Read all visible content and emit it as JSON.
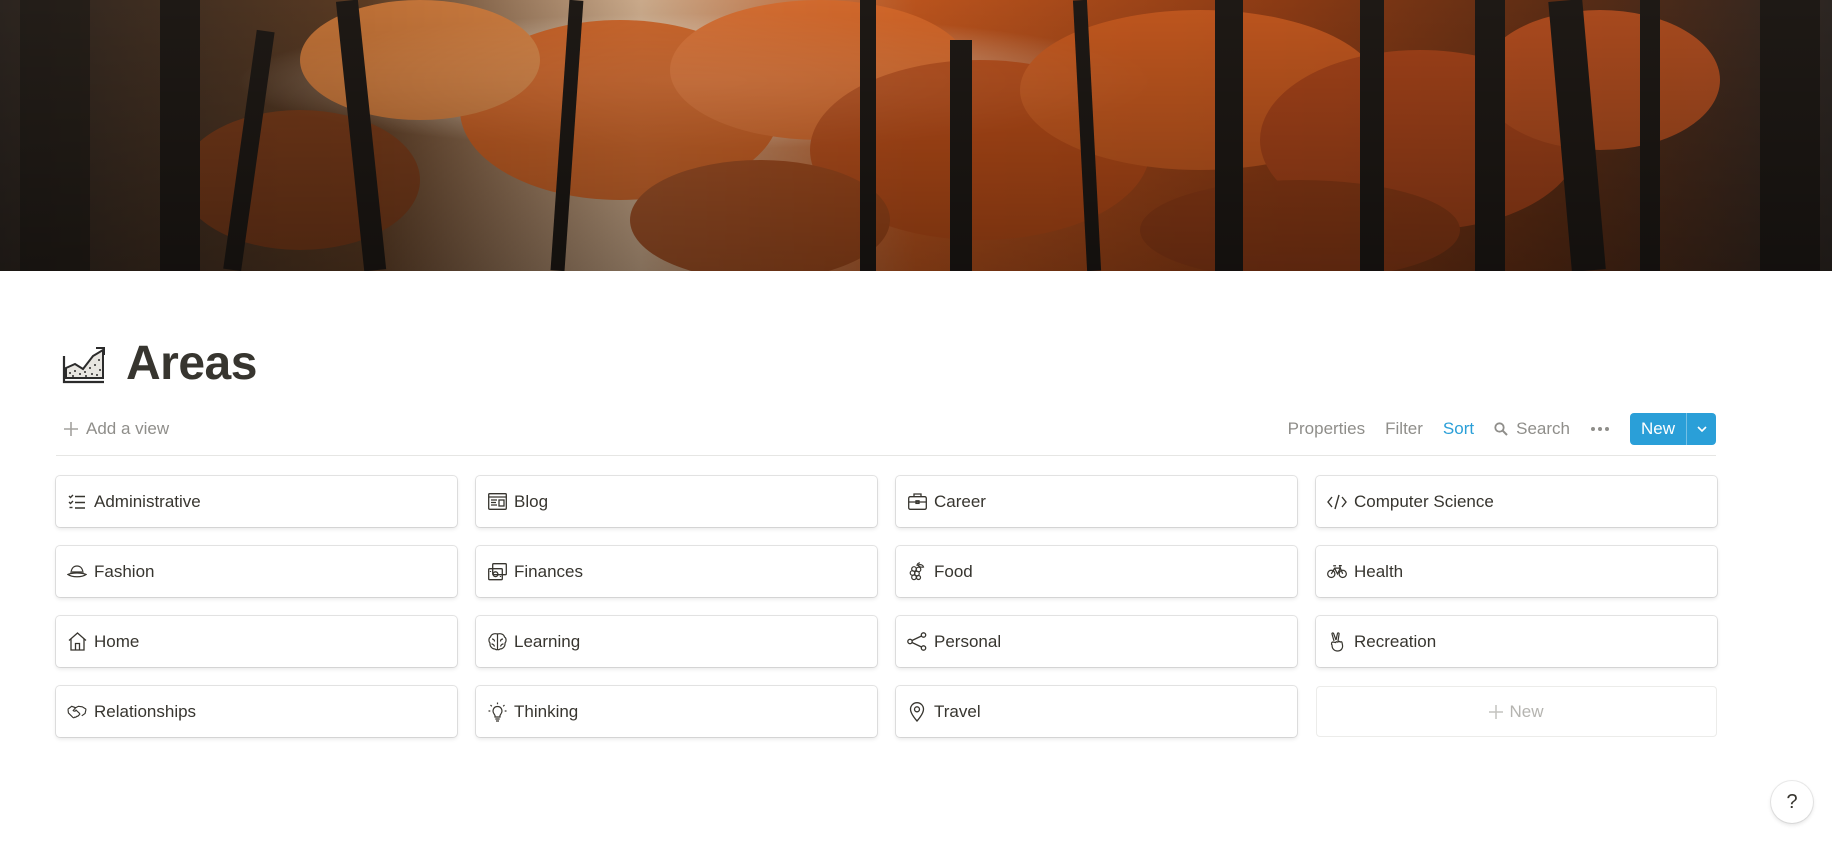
{
  "cover": {
    "description_icon": "autumn-forest-cover-image"
  },
  "page": {
    "icon": "chart-area-icon",
    "title": "Areas"
  },
  "toolbar": {
    "add_view": "Add a view",
    "properties": "Properties",
    "filter": "Filter",
    "sort": "Sort",
    "search": "Search",
    "new": "New"
  },
  "accent_color": "#2a9fd8",
  "cards": [
    {
      "label": "Administrative",
      "icon": "checklist-icon"
    },
    {
      "label": "Blog",
      "icon": "browser-icon"
    },
    {
      "label": "Career",
      "icon": "briefcase-icon"
    },
    {
      "label": "Computer Science",
      "icon": "code-icon"
    },
    {
      "label": "Fashion",
      "icon": "hat-icon"
    },
    {
      "label": "Finances",
      "icon": "money-icon"
    },
    {
      "label": "Food",
      "icon": "grapes-icon"
    },
    {
      "label": "Health",
      "icon": "bicycle-icon"
    },
    {
      "label": "Home",
      "icon": "house-icon"
    },
    {
      "label": "Learning",
      "icon": "brain-icon"
    },
    {
      "label": "Personal",
      "icon": "share-nodes-icon"
    },
    {
      "label": "Recreation",
      "icon": "peace-hand-icon"
    },
    {
      "label": "Relationships",
      "icon": "handshake-icon"
    },
    {
      "label": "Thinking",
      "icon": "lightbulb-icon"
    },
    {
      "label": "Travel",
      "icon": "map-pin-icon"
    }
  ],
  "new_card": "New",
  "help": "?"
}
